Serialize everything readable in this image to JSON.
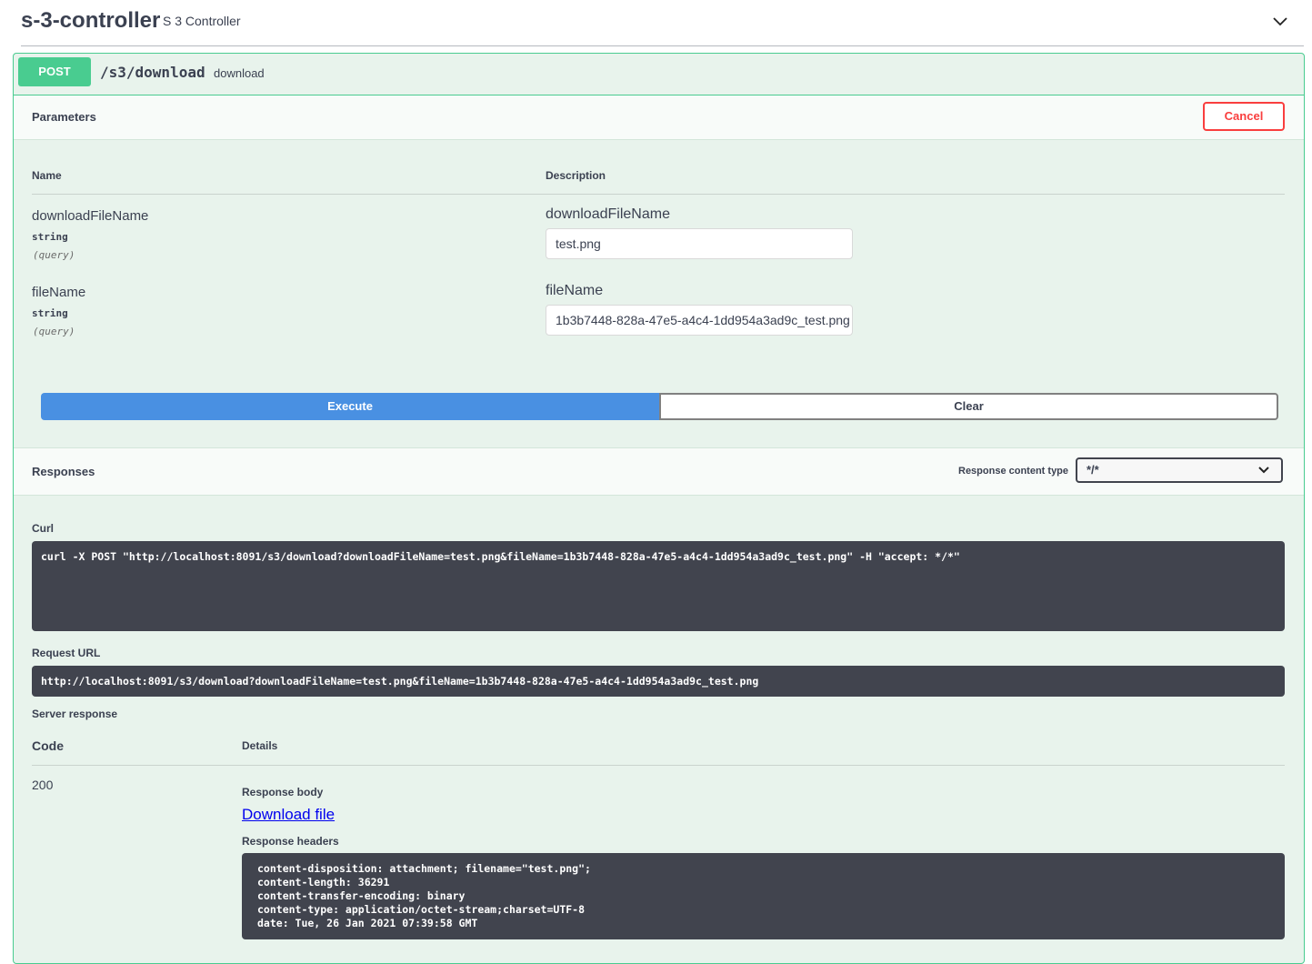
{
  "tag": {
    "name": "s-3-controller",
    "description": "S 3 Controller",
    "toggle_icon": "chevron-down-icon"
  },
  "operation": {
    "method": "POST",
    "path": "/s3/download",
    "description": "download",
    "color": "#49cc90"
  },
  "parameters": {
    "title": "Parameters",
    "cancel_label": "Cancel",
    "col_name": "Name",
    "col_description": "Description",
    "items": [
      {
        "name": "downloadFileName",
        "type": "string",
        "in": "(query)",
        "label": "downloadFileName",
        "value": "test.png"
      },
      {
        "name": "fileName",
        "type": "string",
        "in": "(query)",
        "label": "fileName",
        "value": "1b3b7448-828a-47e5-a4c4-1dd954a3ad9c_test.png"
      }
    ]
  },
  "actions": {
    "execute_label": "Execute",
    "clear_label": "Clear"
  },
  "responses": {
    "title": "Responses",
    "content_type_label": "Response content type",
    "content_type_value": "*/*",
    "curl_label": "Curl",
    "curl": "curl -X POST \"http://localhost:8091/s3/download?downloadFileName=test.png&fileName=1b3b7448-828a-47e5-a4c4-1dd954a3ad9c_test.png\" -H \"accept: */*\"",
    "request_url_label": "Request URL",
    "request_url": "http://localhost:8091/s3/download?downloadFileName=test.png&fileName=1b3b7448-828a-47e5-a4c4-1dd954a3ad9c_test.png",
    "server_response_label": "Server response",
    "code_label": "Code",
    "details_label": "Details",
    "code": "200",
    "body_label": "Response body",
    "download_link": "Download file",
    "headers_label": "Response headers",
    "headers": [
      "content-disposition: attachment; filename=\"test.png\";",
      "content-length: 36291",
      "content-transfer-encoding: binary",
      "content-type: application/octet-stream;charset=UTF-8",
      "date: Tue, 26 Jan 2021 07:39:58 GMT"
    ]
  }
}
